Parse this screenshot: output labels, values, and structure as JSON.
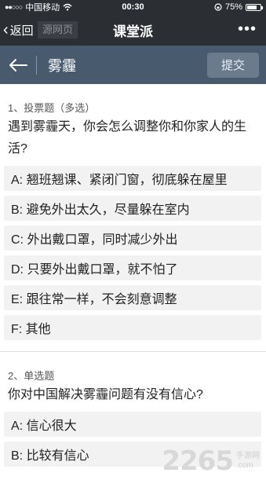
{
  "status_bar": {
    "signal": "●●○○○",
    "carrier": "中国移动",
    "wifi_icon": "wifi-icon",
    "time": "00:30",
    "lock_icon": "rotation-lock-icon",
    "battery_percent": "75%",
    "battery_level": 0.75
  },
  "wechat_bar": {
    "back_label": "返回",
    "back_overlay": "源网页",
    "title": "课堂派",
    "more_icon": "•••"
  },
  "header": {
    "title": "雾霾",
    "submit_label": "提交",
    "colors": {
      "background": "#475a6e",
      "button": "#6b7b8c"
    }
  },
  "questions": [
    {
      "heading": "1、投票题（多选）",
      "text": "遇到雾霾天，你会怎么调整你和你家人的生活?",
      "options": [
        "A: 翘班翘课、紧闭门窗，彻底躲在屋里",
        "B: 避免外出太久，尽量躲在室内",
        "C: 外出戴口罩，同时减少外出",
        "D: 只要外出戴口罩，就不怕了",
        "E: 跟往常一样，不会刻意调整",
        "F: 其他"
      ]
    },
    {
      "heading": "2、单选题",
      "text": "你对中国解决雾霾问题有没有信心?",
      "options": [
        "A: 信心很大",
        "B: 比较有信心"
      ]
    }
  ],
  "watermark": {
    "number": "2265",
    "site_cn": "手游网",
    "site_en": ".com"
  }
}
